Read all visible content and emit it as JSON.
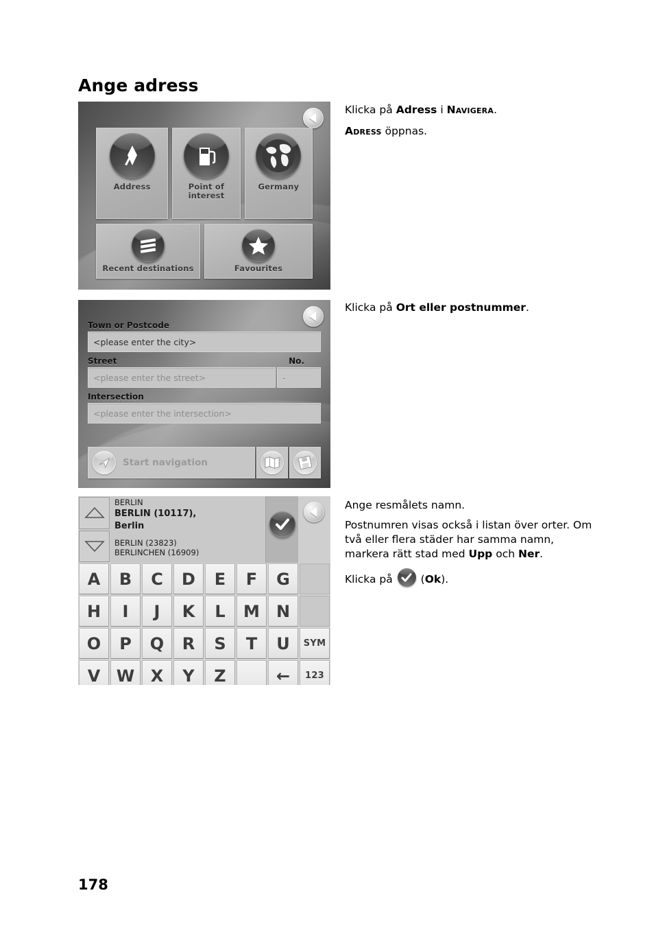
{
  "page": {
    "title": "Ange adress",
    "number": "178"
  },
  "screenshot_menu": {
    "back_icon": "back-arrow-icon",
    "tiles": [
      {
        "label": "Address",
        "icon": "signpost-flag-icon"
      },
      {
        "label": "Point of\ninterest",
        "label_line1": "Point of",
        "label_line2": "interest",
        "icon": "fuel-pump-icon"
      },
      {
        "label": "Germany",
        "icon": "globe-icon"
      },
      {
        "label": "Recent destinations",
        "icon": "list-lines-icon"
      },
      {
        "label": "Favourites",
        "icon": "star-icon"
      }
    ]
  },
  "screenshot_form": {
    "back_icon": "back-arrow-icon",
    "labels": {
      "town": "Town or Postcode",
      "street": "Street",
      "no": "No.",
      "intersection": "Intersection"
    },
    "fields": {
      "town_value": "<please enter the city>",
      "street_placeholder": "<please enter the street>",
      "no_value": "-",
      "intersection_placeholder": "<please enter the intersection>"
    },
    "actions": {
      "start_navigation": "Start navigation",
      "start_navigation_icon": "navigation-arrow-icon",
      "map_button_icon": "map-icon",
      "save_button_icon": "book-save-icon"
    }
  },
  "screenshot_keyboard": {
    "back_icon": "back-arrow-icon",
    "scroll_up_icon": "triangle-up-icon",
    "scroll_down_icon": "triangle-down-icon",
    "ok_icon": "checkmark-icon",
    "list": [
      {
        "text": "BERLIN",
        "selected": false
      },
      {
        "text": "BERLIN (10117),",
        "selected": true
      },
      {
        "text": "Berlin",
        "selected": true
      },
      {
        "text": "BERLIN (23823)",
        "selected": false
      },
      {
        "text": "BERLINCHEN (16909)",
        "selected": false
      }
    ],
    "keyboard_rows": [
      [
        "A",
        "B",
        "C",
        "D",
        "E",
        "F",
        "G",
        ""
      ],
      [
        "H",
        "I",
        "J",
        "K",
        "L",
        "M",
        "N",
        ""
      ],
      [
        "O",
        "P",
        "Q",
        "R",
        "S",
        "T",
        "U",
        "SYM"
      ],
      [
        "V",
        "W",
        "X",
        "Y",
        "Z",
        "_",
        "←",
        "123"
      ]
    ]
  },
  "instructions": {
    "step1": {
      "line1_pre": "Klicka på ",
      "line1_bold": "Adress",
      "line1_mid": " i ",
      "line1_sc": "Navigera",
      "line1_post": ".",
      "line2_sc": "Adress",
      "line2_post": " öppnas."
    },
    "step2": {
      "pre": "Klicka på ",
      "bold": "Ort eller postnummer",
      "post": "."
    },
    "step3": {
      "p1": "Ange resmålets namn.",
      "p2_a": "Postnumren visas också i listan över orter. Om två eller flera städer har samma namn, markera rätt stad med ",
      "p2_b": "Upp",
      "p2_c": " och ",
      "p2_d": "Ner",
      "p2_e": ".",
      "p3_pre": "Klicka på ",
      "p3_open": " (",
      "p3_bold": "Ok",
      "p3_close": ")."
    }
  },
  "colors": {
    "page_bg": "#ffffff",
    "text": "#000000",
    "device_bg_dark": "#4b4b4b",
    "tile_bg": "#b8b8b8",
    "key_bg": "#ececec",
    "list_bg": "#c9c9c9"
  }
}
